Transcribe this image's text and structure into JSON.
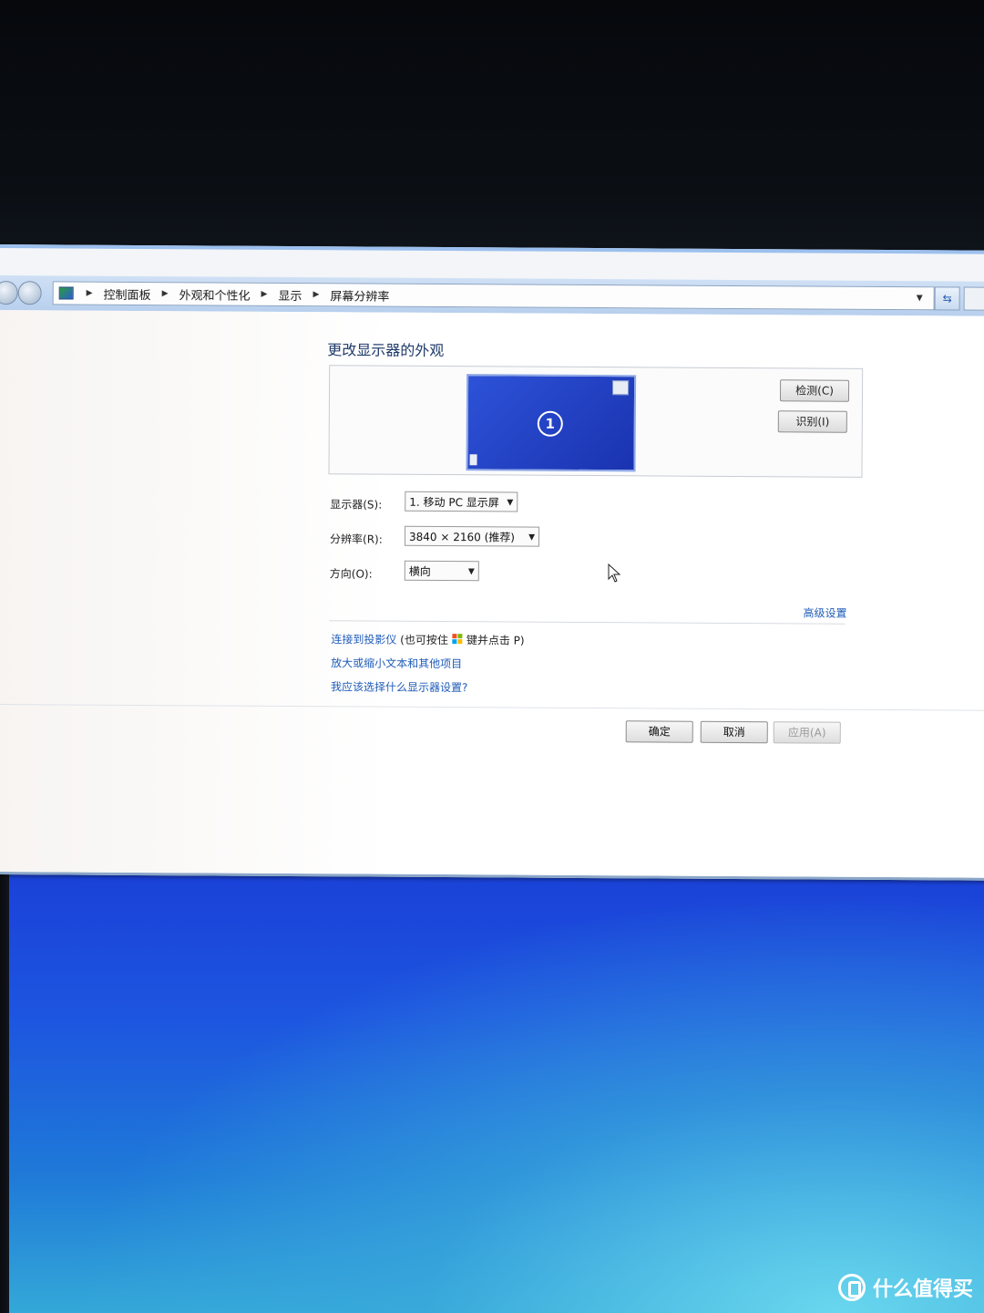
{
  "breadcrumb": [
    "控制面板",
    "外观和个性化",
    "显示",
    "屏幕分辨率"
  ],
  "heading": "更改显示器的外观",
  "monitor_number": "1",
  "buttons": {
    "detect": "检测(C)",
    "identify": "识别(I)"
  },
  "fields": {
    "display": {
      "label": "显示器(S):",
      "value": "1. 移动 PC 显示屏"
    },
    "resolution": {
      "label": "分辨率(R):",
      "value": "3840 × 2160 (推荐)"
    },
    "orientation": {
      "label": "方向(O):",
      "value": "横向"
    }
  },
  "advanced_link": "高级设置",
  "links": {
    "projector_prefix": "连接到投影仪",
    "projector_hint_a": "(也可按住",
    "projector_hint_b": "键并点击 P)",
    "text_size": "放大或缩小文本和其他项目",
    "which_settings": "我应该选择什么显示器设置?"
  },
  "dialog_buttons": {
    "ok": "确定",
    "cancel": "取消",
    "apply": "应用(A)"
  },
  "watermark": "什么值得买",
  "colors": {
    "monitor_tile": "#2d52d8",
    "link": "#1f5cb8",
    "desktop": "#1d55e0"
  }
}
